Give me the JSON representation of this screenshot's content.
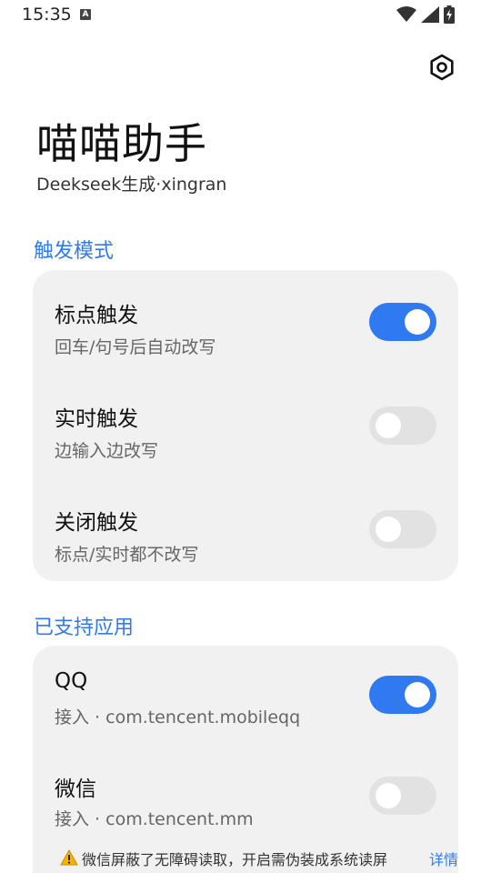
{
  "status_bar": {
    "time": "15:35",
    "notification_icon": "a-text-icon",
    "icons": [
      "wifi-icon",
      "signal-icon",
      "battery-charging-icon"
    ]
  },
  "header": {
    "settings_icon": "gear-icon",
    "title": "喵喵助手",
    "subtitle": "Deekseek生成·xingran"
  },
  "trigger_section": {
    "header": "触发模式",
    "items": [
      {
        "title": "标点触发",
        "subtitle": "回车/句号后自动改写",
        "enabled": true
      },
      {
        "title": "实时触发",
        "subtitle": "边输入边改写",
        "enabled": false
      },
      {
        "title": "关闭触发",
        "subtitle": "标点/实时都不改写",
        "enabled": false
      }
    ]
  },
  "apps_section": {
    "header": "已支持应用",
    "items": [
      {
        "title": "QQ",
        "subtitle": "接入 · com.tencent.mobileqq",
        "enabled": true
      },
      {
        "title": "微信",
        "subtitle": "接入 · com.tencent.mm",
        "enabled": false
      }
    ],
    "warning": {
      "icon": "warning-icon",
      "text": "微信屏蔽了无障碍读取，开启需伪装成系统读屏",
      "link": "详情"
    }
  },
  "colors": {
    "accent": "#2f7af0",
    "card_background": "#f1f1f1",
    "toggle_off": "#e2e2e2"
  }
}
